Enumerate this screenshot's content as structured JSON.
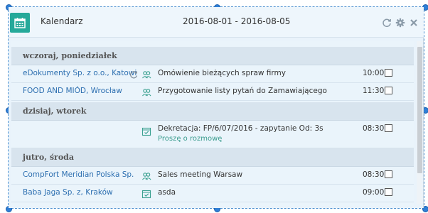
{
  "header": {
    "title": "Kalendarz",
    "date_range": "2016-08-01 - 2016-08-05",
    "icon": "calendar-icon",
    "accent": "#25a99a",
    "actions": [
      "refresh-icon",
      "gear-icon",
      "close-icon"
    ]
  },
  "sections": [
    {
      "label": "wczoraj, poniedziałek",
      "rows": [
        {
          "client": "eDokumenty Sp. z o.o., Katowi",
          "icons": [
            "repeat-icon",
            "meeting-icon"
          ],
          "desc": "Omówienie bieżących spraw firmy",
          "sub": "",
          "time": "10:00"
        },
        {
          "client": "FOOD AND MIÓD, Wrocław",
          "icons": [
            "meeting-icon"
          ],
          "desc": "Przygotowanie listy pytań do Zamawiającego",
          "sub": "",
          "time": "11:30"
        }
      ]
    },
    {
      "label": "dzisiaj, wtorek",
      "rows": [
        {
          "client": "",
          "icons": [
            "task-icon"
          ],
          "desc": "Dekretacja: FP/6/07/2016 - zapytanie Od: 3s",
          "sub": "Proszę o rozmowę",
          "time": "08:30"
        }
      ]
    },
    {
      "label": "jutro, środa",
      "rows": [
        {
          "client": "CompFort Meridian Polska Sp.",
          "icons": [
            "meeting-icon"
          ],
          "desc": "Sales meeting Warsaw",
          "sub": "",
          "time": "08:30"
        },
        {
          "client": "Baba Jaga Sp. z, Kraków",
          "icons": [
            "task-icon"
          ],
          "desc": "asda",
          "sub": "",
          "time": "09:00"
        }
      ]
    }
  ]
}
